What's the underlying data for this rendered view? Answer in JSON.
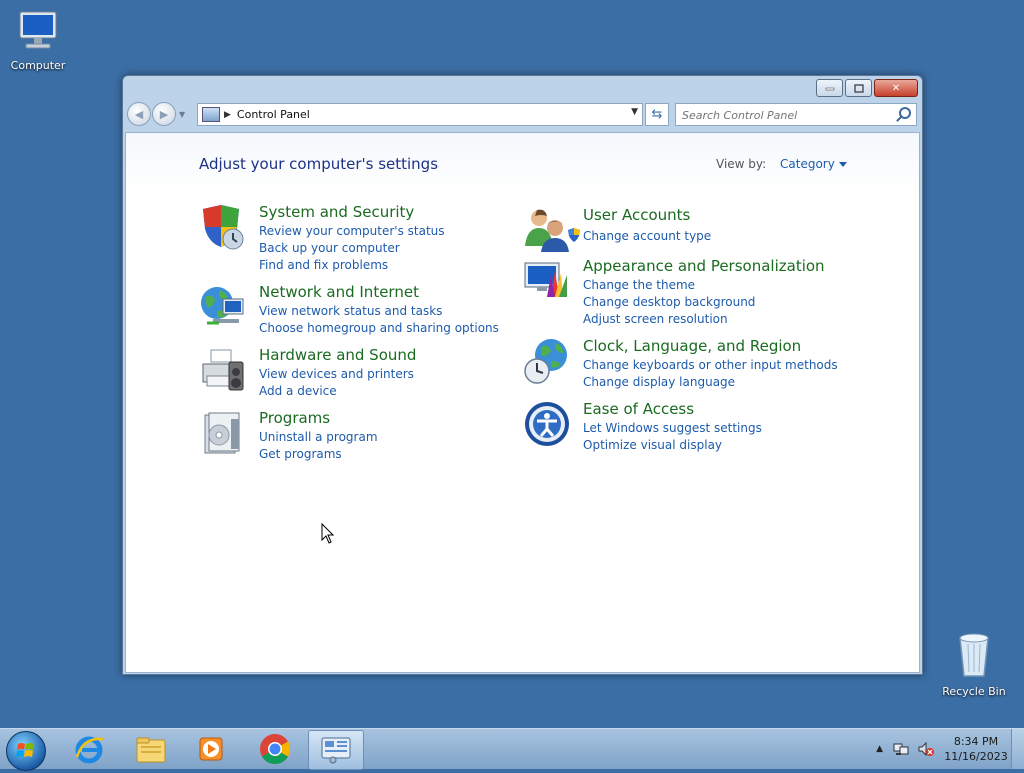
{
  "desktop": {
    "computer_label": "Computer",
    "recycle_label": "Recycle Bin"
  },
  "window": {
    "address_path": "Control Panel",
    "search_placeholder": "Search Control Panel",
    "page_title": "Adjust your computer's settings",
    "view_by_label": "View by:",
    "view_by_value": "Category",
    "categories": [
      {
        "title": "System and Security",
        "icon": "shield-icon",
        "links": [
          "Review your computer's status",
          "Back up your computer",
          "Find and fix problems"
        ]
      },
      {
        "title": "Network and Internet",
        "icon": "globe-icon",
        "links": [
          "View network status and tasks",
          "Choose homegroup and sharing options"
        ]
      },
      {
        "title": "Hardware and Sound",
        "icon": "printer-icon",
        "links": [
          "View devices and printers",
          "Add a device"
        ]
      },
      {
        "title": "Programs",
        "icon": "programs-icon",
        "links": [
          "Uninstall a program",
          "Get programs"
        ]
      },
      {
        "title": "User Accounts",
        "icon": "users-icon",
        "links": [
          "Change account type"
        ]
      },
      {
        "title": "Appearance and Personalization",
        "icon": "appearance-icon",
        "links": [
          "Change the theme",
          "Change desktop background",
          "Adjust screen resolution"
        ]
      },
      {
        "title": "Clock, Language, and Region",
        "icon": "clock-globe-icon",
        "links": [
          "Change keyboards or other input methods",
          "Change display language"
        ]
      },
      {
        "title": "Ease of Access",
        "icon": "ease-of-access-icon",
        "links": [
          "Let Windows suggest settings",
          "Optimize visual display"
        ]
      }
    ]
  },
  "taskbar": {
    "apps": [
      "start-orb",
      "internet-explorer-icon",
      "file-explorer-icon",
      "media-player-icon",
      "chrome-icon",
      "control-panel-icon"
    ],
    "time": "8:34 PM",
    "date": "11/16/2023"
  }
}
